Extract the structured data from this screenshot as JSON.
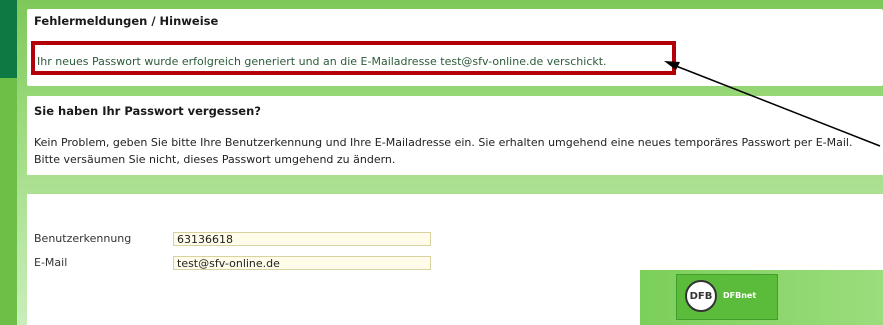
{
  "notices": {
    "heading": "Fehlermeldungen / Hinweise",
    "message": "Ihr neues Passwort wurde erfolgreich generiert und an die E-Mailadresse test@sfv-online.de verschickt."
  },
  "forgot": {
    "heading": "Sie haben Ihr Passwort vergessen?",
    "text": "Kein Problem, geben Sie bitte Ihre Benutzerkennung und Ihre E-Mailadresse ein. Sie erhalten umgehend eine neues temporäres Passwort per E-Mail. Bitte versäumen Sie nicht, dieses Passwort umgehend zu ändern."
  },
  "form": {
    "username_label": "Benutzerkennung",
    "username_value": "63136618",
    "email_label": "E-Mail",
    "email_value": "test@sfv-online.de"
  },
  "logo": {
    "text": "DFBnet"
  },
  "colors": {
    "highlight_border": "#b30008",
    "brand_green": "#5bbc3c",
    "dark_green": "#0d7a43"
  }
}
